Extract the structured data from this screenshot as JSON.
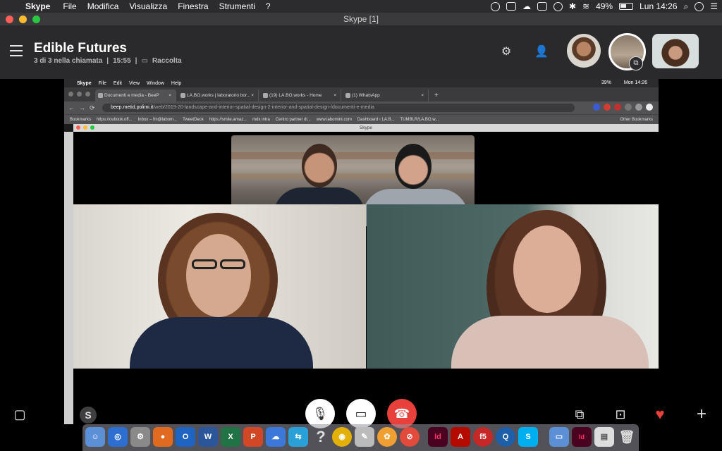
{
  "menubar": {
    "app": "Skype",
    "items": [
      "File",
      "Modifica",
      "Visualizza",
      "Finestra",
      "Strumenti",
      "?"
    ],
    "battery": "49%",
    "clock": "Lun 14:26"
  },
  "window": {
    "title": "Skype [1]"
  },
  "chat": {
    "title": "Edible Futures",
    "participants": "3 di 3 nella chiamata",
    "duration": "15:55",
    "gallery": "Raccolta"
  },
  "shared": {
    "menubar": {
      "app": "Skype",
      "items": [
        "File",
        "Edit",
        "View",
        "Window",
        "Help"
      ],
      "battery": "39%",
      "clock": "Mon 14:26"
    },
    "tabs": [
      {
        "label": "Documenti e media - BeeP",
        "active": true
      },
      {
        "label": "LA.BO.works | laboratorio bor...",
        "active": false
      },
      {
        "label": "(19) LA.BO.works - Home",
        "active": false
      },
      {
        "label": "(1) WhatsApp",
        "active": false
      }
    ],
    "url_host": "beep.metid.polimi.it",
    "url_path": "/web/2019-20-landscape-and-interior-spatial-design-2-interior-and-spatial-design-/documenti-e-media",
    "bookmarks": [
      "Bookmarks",
      "https://outlook.off...",
      "Inbox – fm@labom...",
      "TweetDeck",
      "https://smile.amaz...",
      "mdx intra",
      "Centro partner di...",
      "www.labomint.com",
      "Dashboard ‹ LA.B...",
      "TUMBLR/LA.BO.w..."
    ],
    "other_bookmarks": "Other Bookmarks",
    "inner_window_title": "Skype"
  },
  "controls": {
    "mic": "microphone-icon",
    "video": "video-camera-icon",
    "hangup": "end-call-icon"
  },
  "colors": {
    "hangup": "#e8413b",
    "heart": "#e8413b",
    "header_bg": "#2a2a2c"
  }
}
